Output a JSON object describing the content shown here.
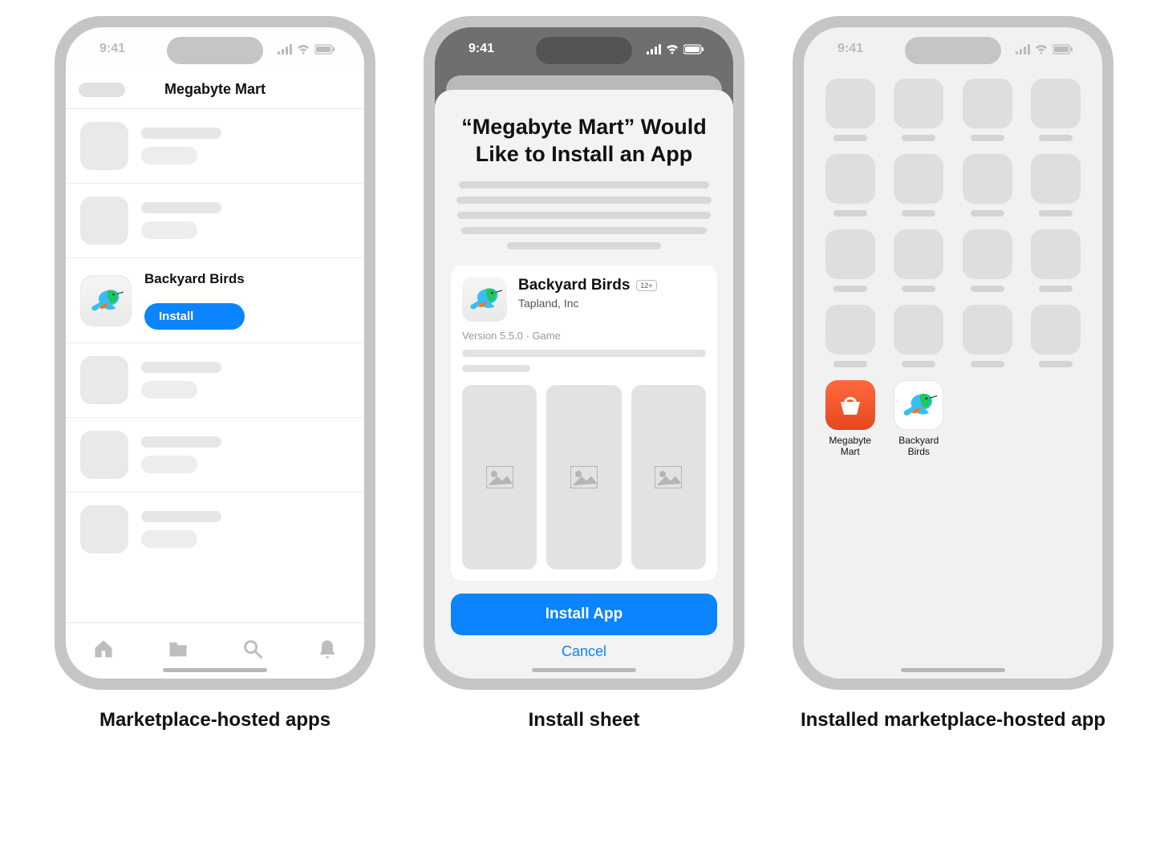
{
  "status": {
    "time": "9:41"
  },
  "screen1": {
    "nav_title": "Megabyte Mart",
    "app_name": "Backyard Birds",
    "install_label": "Install",
    "tabs": [
      "home",
      "files",
      "search",
      "alerts"
    ],
    "caption": "Marketplace-hosted apps"
  },
  "screen2": {
    "sheet_title": "“Megabyte Mart” Would Like to Install an App",
    "app_name": "Backyard Birds",
    "developer": "Tapland, Inc",
    "age_rating": "12+",
    "meta": "Version 5.5.0 · Game",
    "install_button": "Install App",
    "cancel": "Cancel",
    "caption": "Install sheet"
  },
  "screen3": {
    "apps": [
      {
        "name": "Megabyte Mart"
      },
      {
        "name": "Backyard Birds"
      }
    ],
    "caption": "Installed marketplace-hosted app"
  }
}
